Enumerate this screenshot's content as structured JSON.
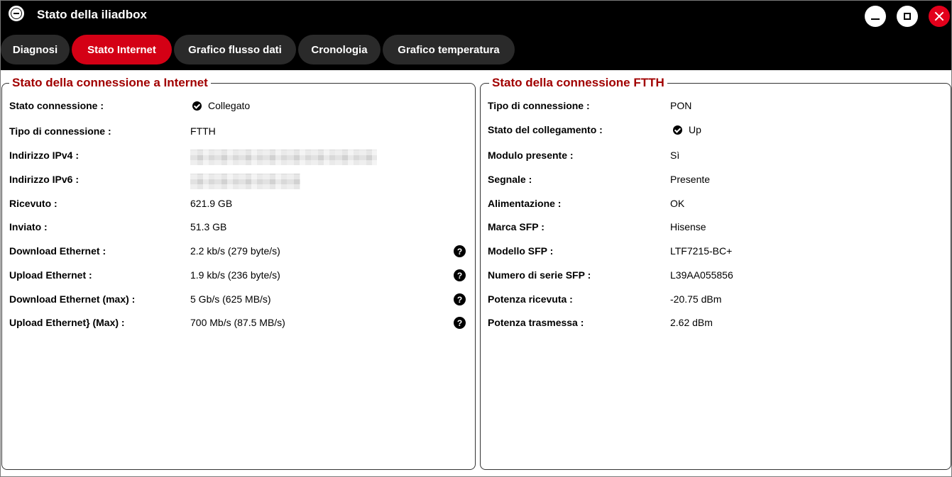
{
  "window": {
    "title": "Stato della iliadbox",
    "app_icon": "iliadbox-logo-icon",
    "controls": {
      "minimize": "minimize-icon",
      "maximize": "maximize-icon",
      "close": "close-icon"
    },
    "accent_color": "#d40015"
  },
  "tabs": [
    {
      "label": "Diagnosi",
      "active": false
    },
    {
      "label": "Stato Internet",
      "active": true
    },
    {
      "label": "Grafico flusso dati",
      "active": false
    },
    {
      "label": "Cronologia",
      "active": false
    },
    {
      "label": "Grafico temperatura",
      "active": false
    }
  ],
  "internet": {
    "legend": "Stato della connessione a Internet",
    "rows": [
      {
        "label": "Stato connessione :",
        "value": "Collegato",
        "status_icon": "check-circle-icon"
      },
      {
        "label": "Tipo di connessione :",
        "value": "FTTH"
      },
      {
        "label": "Indirizzo IPv4 :",
        "value": "",
        "redacted": true
      },
      {
        "label": "Indirizzo IPv6 :",
        "value": "",
        "redacted": true
      },
      {
        "label": "Ricevuto :",
        "value": "621.9 GB"
      },
      {
        "label": "Inviato :",
        "value": "51.3 GB"
      },
      {
        "label": "Download Ethernet :",
        "value": "2.2 kb/s (279 byte/s)",
        "help": true
      },
      {
        "label": "Upload Ethernet :",
        "value": "1.9 kb/s (236 byte/s)",
        "help": true
      },
      {
        "label": "Download Ethernet (max) :",
        "value": "5 Gb/s (625 MB/s)",
        "help": true
      },
      {
        "label": "Upload Ethernet} (Max) :",
        "value": "700 Mb/s (87.5 MB/s)",
        "help": true
      }
    ]
  },
  "ftth": {
    "legend": "Stato della connessione FTTH",
    "rows": [
      {
        "label": "Tipo di connessione :",
        "value": "PON"
      },
      {
        "label": "Stato del collegamento :",
        "value": "Up",
        "status_icon": "check-circle-icon"
      },
      {
        "label": "Modulo presente :",
        "value": "Sì"
      },
      {
        "label": "Segnale :",
        "value": "Presente"
      },
      {
        "label": "Alimentazione :",
        "value": "OK"
      },
      {
        "label": "Marca SFP :",
        "value": "Hisense"
      },
      {
        "label": "Modello SFP :",
        "value": "LTF7215-BC+"
      },
      {
        "label": "Numero di serie SFP :",
        "value": "L39AA055856"
      },
      {
        "label": "Potenza ricevuta :",
        "value": "-20.75 dBm"
      },
      {
        "label": "Potenza trasmessa :",
        "value": "2.62 dBm"
      }
    ]
  }
}
